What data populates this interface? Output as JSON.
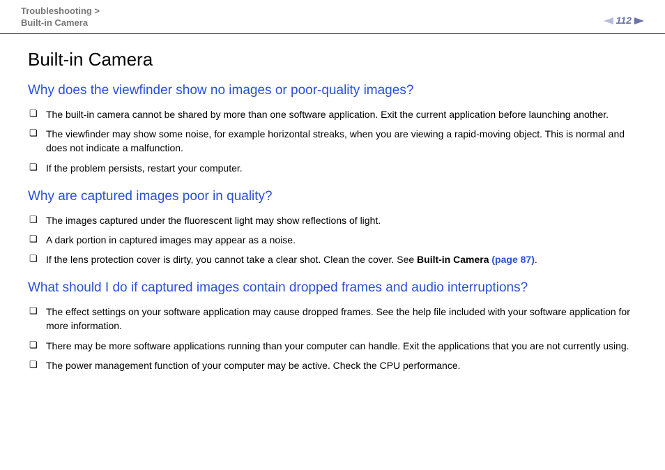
{
  "header": {
    "breadcrumb_line1": "Troubleshooting >",
    "breadcrumb_line2": "Built-in Camera",
    "page_number": "112"
  },
  "title": "Built-in Camera",
  "sections": [
    {
      "heading": "Why does the viewfinder show no images or poor-quality images?",
      "items": [
        "The built-in camera cannot be shared by more than one software application. Exit the current application before launching another.",
        "The viewfinder may show some noise, for example horizontal streaks, when you are viewing a rapid-moving object. This is normal and does not indicate a malfunction.",
        "If the problem persists, restart your computer."
      ]
    },
    {
      "heading": "Why are captured images poor in quality?",
      "items": [
        "The images captured under the fluorescent light may show reflections of light.",
        "A dark portion in captured images may appear as a noise.",
        "If the lens protection cover is dirty, you cannot take a clear shot. Clean the cover. See "
      ],
      "link": {
        "bold": "Built-in Camera ",
        "page": "(page 87)",
        "after": "."
      }
    },
    {
      "heading": "What should I do if captured images contain dropped frames and audio interruptions?",
      "items": [
        "The effect settings on your software application may cause dropped frames. See the help file included with your software application for more information.",
        "There may be more software applications running than your computer can handle. Exit the applications that you are not currently using.",
        "The power management function of your computer may be active. Check the CPU performance."
      ]
    }
  ]
}
